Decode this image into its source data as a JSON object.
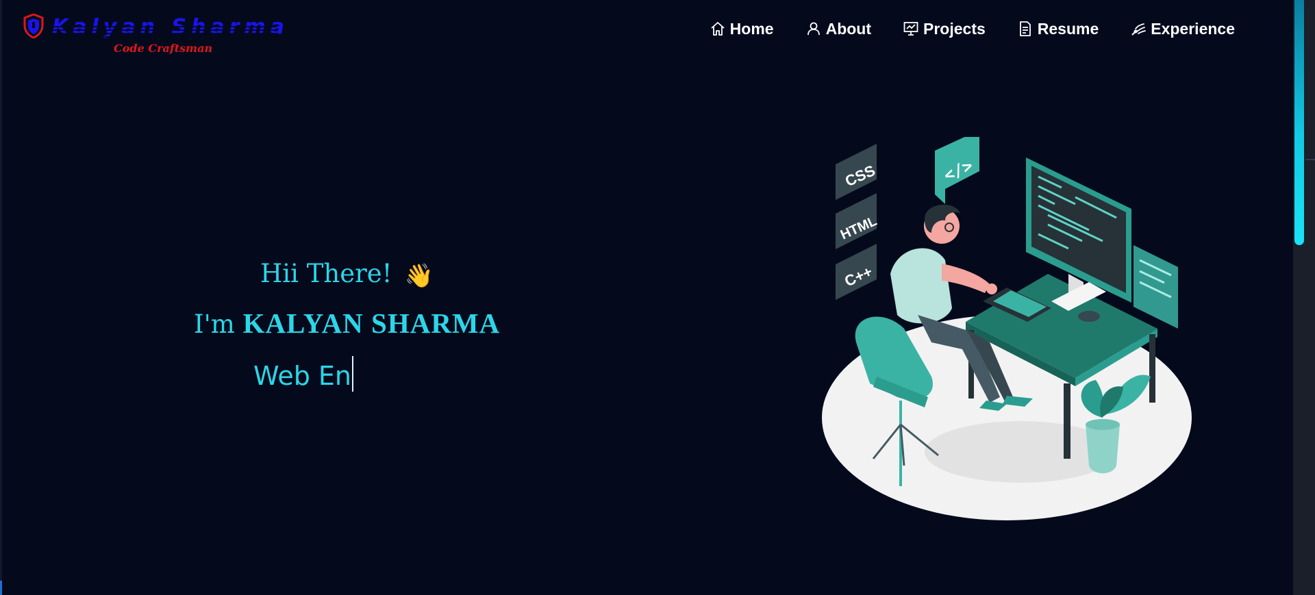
{
  "brand": {
    "name": "Kalyan Sharma",
    "tagline": "Code Craftsman",
    "logo_icon": "shield-logo-icon",
    "name_color": "#1a14e8",
    "tagline_color": "#e0161c"
  },
  "nav": {
    "items": [
      {
        "label": "Home",
        "icon": "home-icon"
      },
      {
        "label": "About",
        "icon": "user-icon"
      },
      {
        "label": "Projects",
        "icon": "presentation-icon"
      },
      {
        "label": "Resume",
        "icon": "document-icon"
      },
      {
        "label": "Experience",
        "icon": "signal-icon"
      }
    ]
  },
  "hero": {
    "greeting": "Hii There!",
    "wave": "👋",
    "intro_prefix": "I'm ",
    "name": "KALYAN SHARMA",
    "typed_text": "Web En"
  },
  "illustration": {
    "badges": [
      "CSS",
      "HTML",
      "C++"
    ],
    "code_bubble": "</>"
  },
  "colors": {
    "background": "#040a1c",
    "accent": "#2bd6e8",
    "nav_text": "#ffffff",
    "teal": "#2a9d8f"
  }
}
